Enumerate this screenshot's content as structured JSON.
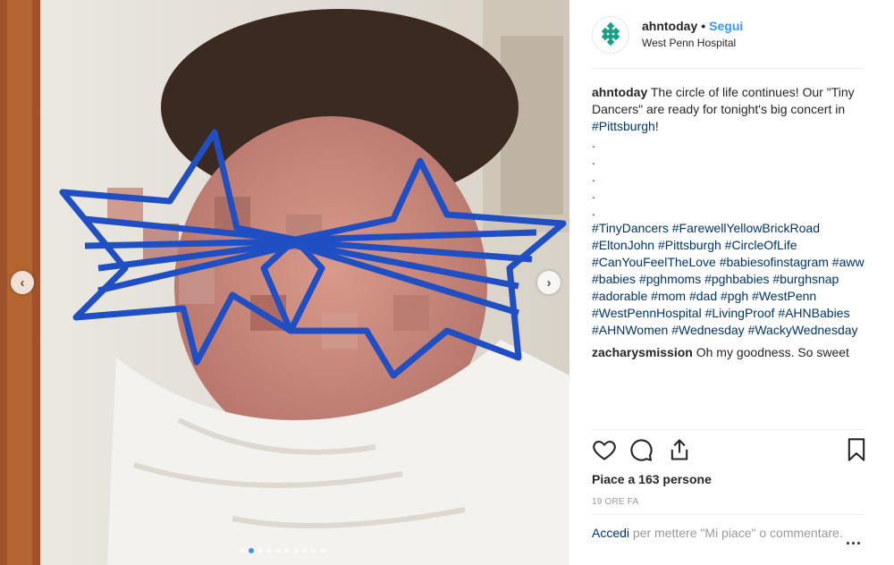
{
  "post": {
    "username": "ahntoday",
    "separator": "•",
    "follow_label": "Segui",
    "location": "West Penn Hospital",
    "caption_user": "ahntoday",
    "caption_text": "The circle of life continues! Our \"Tiny Dancers\" are ready for tonight's big concert in",
    "caption_tag": "#Pittsburgh",
    "caption_end": "!",
    "dot_lines": [
      ".",
      ".",
      ".",
      ".",
      "."
    ],
    "hashtags": [
      "#TinyDancers",
      "#FarewellYellowBrickRoad",
      "#EltonJohn",
      "#Pittsburgh",
      "#CircleOfLife",
      "#CanYouFeelTheLove",
      "#babiesofinstagram",
      "#aww",
      "#babies",
      "#pghmoms",
      "#pghbabies",
      "#burghsnap",
      "#adorable",
      "#mom",
      "#dad",
      "#pgh",
      "#WestPenn",
      "#WestPennHospital",
      "#LivingProof",
      "#AHNBabies",
      "#AHNWomen",
      "#Wednesday",
      "#WackyWednesday"
    ]
  },
  "comment": {
    "user": "zacharysmission",
    "text": "Oh my goodness. So sweet"
  },
  "actions": {
    "icons": [
      "heart-icon",
      "comment-icon",
      "share-icon",
      "bookmark-icon"
    ]
  },
  "likes_text": "Piace a 163 persone",
  "timestamp": "19 ORE FA",
  "footer": {
    "login_link": "Accedi",
    "login_text": "per mettere \"Mi piace\" o commentare.",
    "more": "..."
  },
  "carousel": {
    "slide_count": 10,
    "active_index": 1,
    "prev_glyph": "‹",
    "next_glyph": "›"
  },
  "colors": {
    "link": "#003569",
    "accent": "#3897f0",
    "text": "#262626",
    "muted": "#999999",
    "logo": "#16a085"
  }
}
